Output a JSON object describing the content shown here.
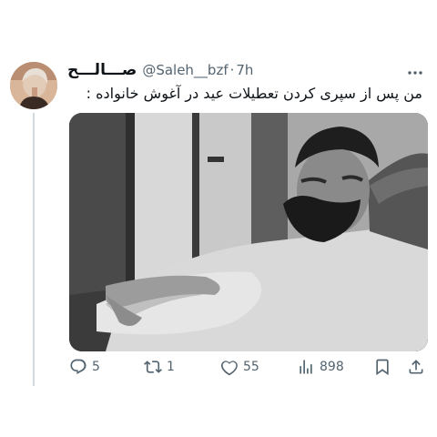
{
  "tweet": {
    "display_name": "صـــالـــح",
    "handle": "@Saleh__bzf",
    "separator": "·",
    "time": "7h",
    "text": "من پس از سپری کردن تعطیلات عید در آغوش خانواده :",
    "more_icon": "more-horizontal-icon",
    "media_description_icon": "photo"
  },
  "actions": {
    "reply": {
      "icon": "reply-icon",
      "count": "5"
    },
    "retweet": {
      "icon": "retweet-icon",
      "count": "1"
    },
    "like": {
      "icon": "like-icon",
      "count": "55"
    },
    "views": {
      "icon": "views-icon",
      "count": "898"
    },
    "bookmark": {
      "icon": "bookmark-icon"
    },
    "share": {
      "icon": "share-icon"
    }
  },
  "colors": {
    "text_primary": "#0f1419",
    "text_secondary": "#536471",
    "thread_line": "#cfd9de"
  }
}
